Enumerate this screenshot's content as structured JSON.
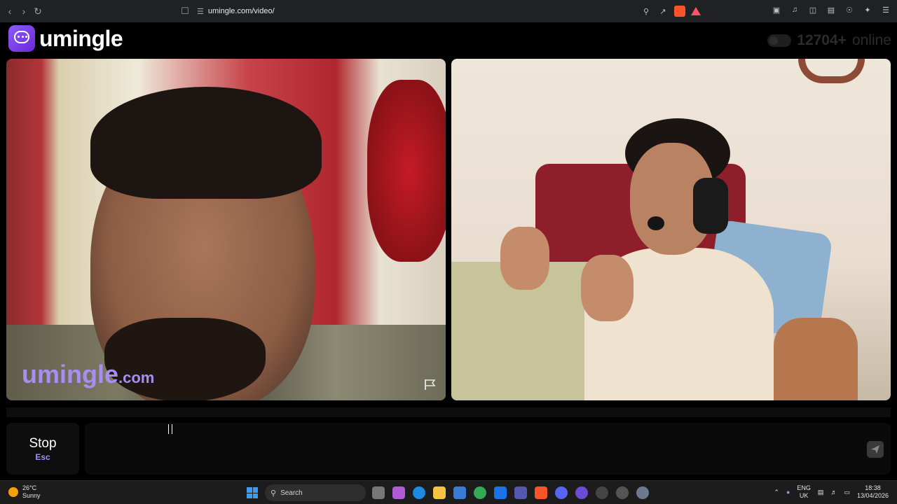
{
  "browser": {
    "url": "umingle.com/video/",
    "icons": [
      "back-icon",
      "forward-icon",
      "reload-icon",
      "bookmark-icon",
      "zoom-icon",
      "share-icon",
      "brave-shields-icon",
      "brave-rewards-icon",
      "sidebar-icon",
      "music-icon",
      "reading-list-icon",
      "wallet-icon",
      "vpn-icon",
      "extensions-icon",
      "menu-icon"
    ]
  },
  "app": {
    "logo_text": "umingle",
    "online_count": "12704+",
    "online_label": "online"
  },
  "video": {
    "watermark_main": "umingle",
    "watermark_suffix": ".com"
  },
  "chat": {
    "stop_label": "Stop",
    "stop_key": "Esc",
    "input_value": ""
  },
  "taskbar": {
    "temperature": "26°C",
    "weather": "Sunny",
    "search_label": "Search",
    "language_top": "ENG",
    "language_bottom": "UK",
    "time": "18:38",
    "date": "13/04/2026"
  },
  "colors": {
    "accent": "#8b5cf6",
    "watermark": "#a58ff2",
    "stop_key": "#a78bfa"
  }
}
